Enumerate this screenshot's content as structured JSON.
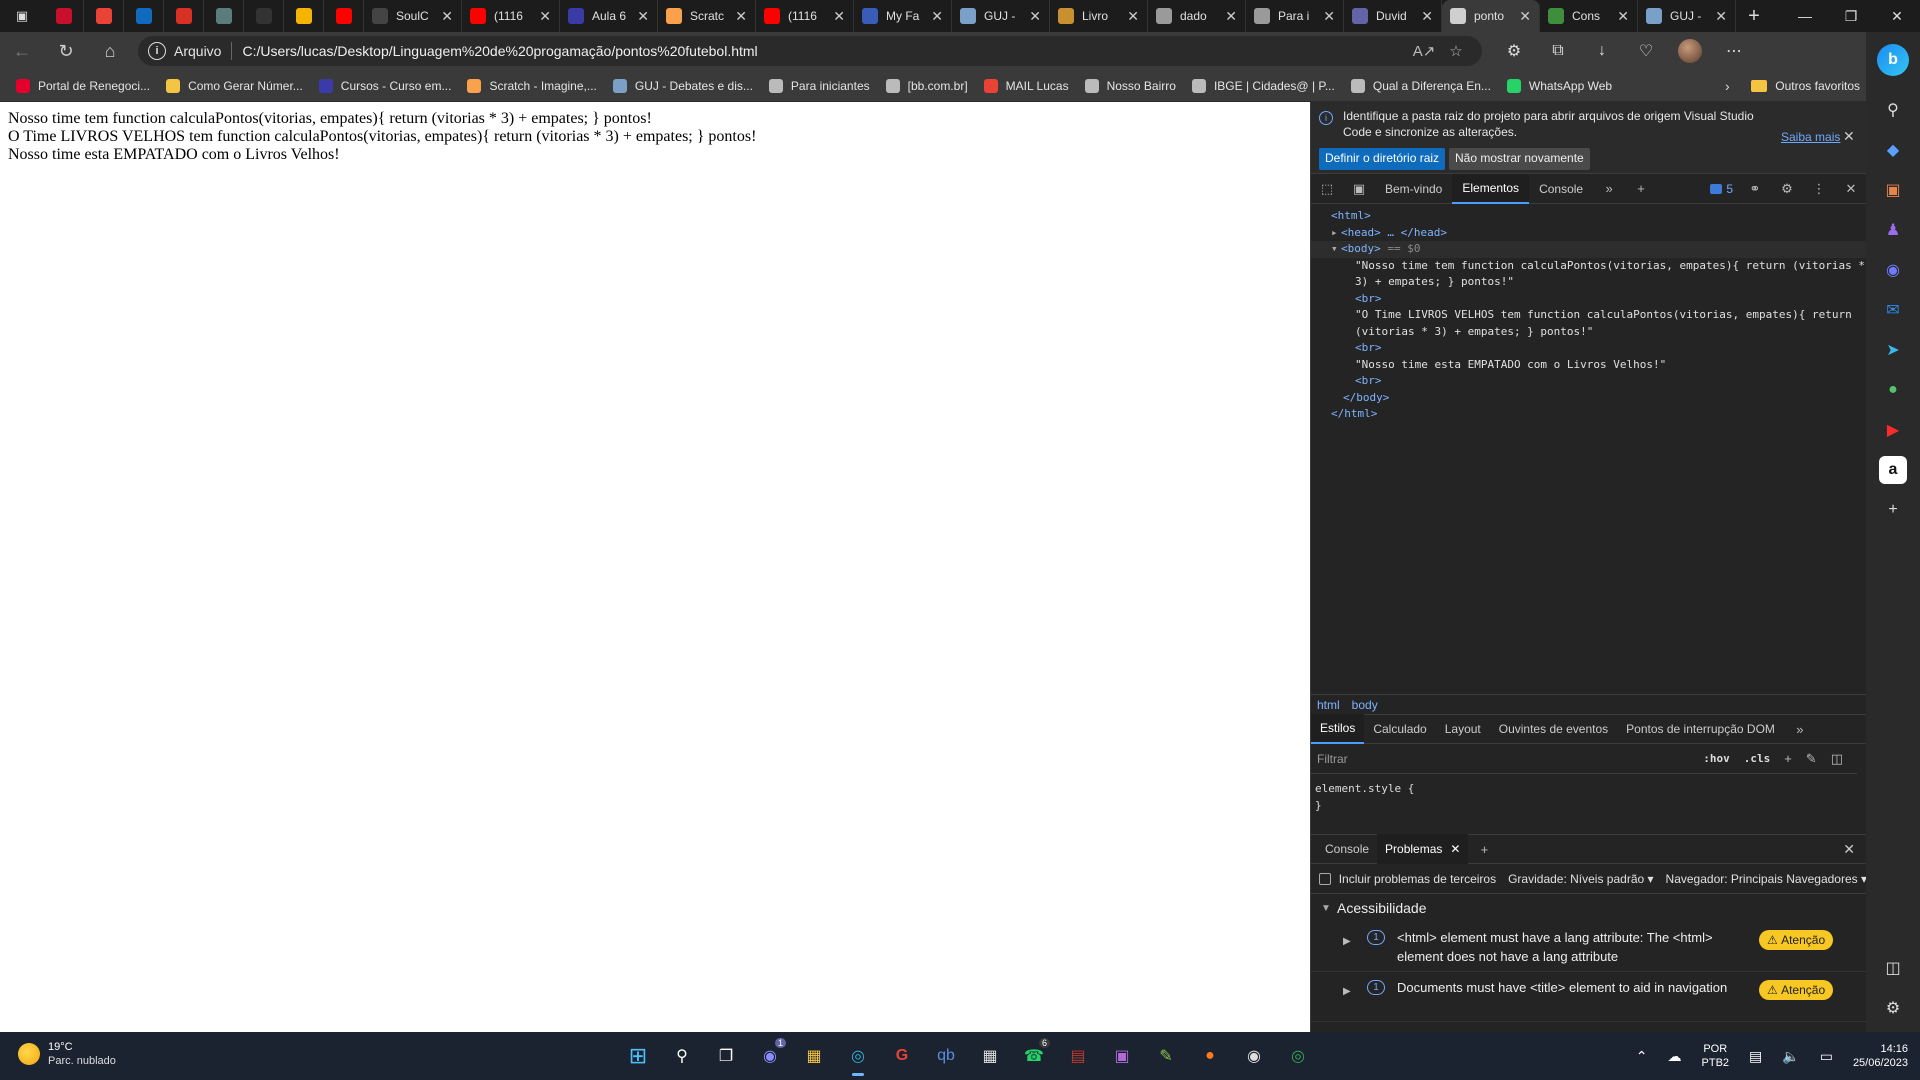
{
  "tabs": [
    {
      "title": "",
      "icon": "yammer-icon",
      "color": "#c8102e",
      "mini": true
    },
    {
      "title": "",
      "icon": "gmail-icon",
      "color": "#ea4335",
      "mini": true
    },
    {
      "title": "",
      "icon": "outlook-icon",
      "color": "#0f6cbd",
      "mini": true
    },
    {
      "title": "",
      "icon": "g-icon",
      "color": "#d93025",
      "mini": true
    },
    {
      "title": "",
      "icon": "generic-site-icon",
      "color": "#5a7d7c",
      "mini": true
    },
    {
      "title": "",
      "icon": "terminal-icon",
      "color": "#333333",
      "mini": true
    },
    {
      "title": "",
      "icon": "maps-pin-icon",
      "color": "#f4b400",
      "mini": true
    },
    {
      "title": "",
      "icon": "youtube-icon",
      "color": "#ff0000",
      "mini": true
    },
    {
      "title": "SoulC",
      "icon": "generic-site-icon",
      "color": "#444444",
      "mini": false
    },
    {
      "title": "(1116",
      "icon": "youtube-icon",
      "color": "#ff0000",
      "mini": false
    },
    {
      "title": "Aula 6",
      "icon": "generic-site-icon",
      "color": "#3a3aa8",
      "mini": false
    },
    {
      "title": "Scratc",
      "icon": "scratch-icon",
      "color": "#f9a24b",
      "mini": false
    },
    {
      "title": "(1116",
      "icon": "youtube-icon",
      "color": "#ff0000",
      "mini": false
    },
    {
      "title": "My Fa",
      "icon": "generic-site-icon",
      "color": "#3a5bb8",
      "mini": false
    },
    {
      "title": "GUJ -",
      "icon": "guj-icon",
      "color": "#7aa0c8",
      "mini": false
    },
    {
      "title": "Livro",
      "icon": "book-icon",
      "color": "#c8902e",
      "mini": false
    },
    {
      "title": "dado",
      "icon": "file-icon",
      "color": "#9a9a9a",
      "mini": false
    },
    {
      "title": "Para i",
      "icon": "file-icon",
      "color": "#9a9a9a",
      "mini": false
    },
    {
      "title": "Duvid",
      "icon": "teams-icon",
      "color": "#6264a7",
      "mini": false
    },
    {
      "title": "ponto",
      "icon": "file-icon",
      "color": "#cfcfcf",
      "mini": false,
      "active": true
    },
    {
      "title": "Cons",
      "icon": "generic-site-icon",
      "color": "#3e8e3e",
      "mini": false
    },
    {
      "title": "GUJ -",
      "icon": "guj-icon",
      "color": "#7aa0c8",
      "mini": false
    }
  ],
  "address": {
    "scheme": "Arquivo",
    "url": "C:/Users/lucas/Desktop/Linguagem%20de%20progamação/pontos%20futebol.html"
  },
  "favorites": [
    {
      "label": "Portal de Renegoci...",
      "icon": "serasa-icon",
      "color": "#e4002b"
    },
    {
      "label": "Como Gerar Númer...",
      "icon": "python-icon",
      "color": "#f4c542"
    },
    {
      "label": "Cursos - Curso em...",
      "icon": "cursoemvideo-icon",
      "color": "#3a3aa8"
    },
    {
      "label": "Scratch - Imagine,...",
      "icon": "scratch-icon",
      "color": "#f9a24b"
    },
    {
      "label": "GUJ - Debates e dis...",
      "icon": "guj-icon",
      "color": "#7aa0c8"
    },
    {
      "label": "Para iniciantes",
      "icon": "file-icon",
      "color": "#bbbbbb"
    },
    {
      "label": "[bb.com.br]",
      "icon": "file-icon",
      "color": "#bbbbbb"
    },
    {
      "label": "MAIL Lucas",
      "icon": "gmail-icon",
      "color": "#ea4335"
    },
    {
      "label": "Nosso Bairro",
      "icon": "file-icon",
      "color": "#bbbbbb"
    },
    {
      "label": "IBGE | Cidades@ | P...",
      "icon": "file-icon",
      "color": "#bbbbbb"
    },
    {
      "label": "Qual a Diferença En...",
      "icon": "file-icon",
      "color": "#bbbbbb"
    },
    {
      "label": "WhatsApp Web",
      "icon": "whatsapp-icon",
      "color": "#25d366"
    }
  ],
  "favorites_folder": "Outros favoritos",
  "page": {
    "line1": "Nosso time tem function calculaPontos(vitorias, empates){ return (vitorias * 3) + empates; } pontos!",
    "line2": "O Time LIVROS VELHOS tem function calculaPontos(vitorias, empates){ return (vitorias * 3) + empates; } pontos!",
    "line3": "Nosso time esta EMPATADO com o Livros Velhos!"
  },
  "devtools": {
    "infobar": {
      "message": "Identifique a pasta raiz do projeto para abrir arquivos de origem Visual Studio Code e sincronize as alterações.",
      "learn_more": "Saiba mais",
      "primary": "Definir o diretório raiz",
      "secondary": "Não mostrar novamente"
    },
    "tabs": [
      "Bem-vindo",
      "Elementos",
      "Console"
    ],
    "issues_count": "5",
    "dom": {
      "html_open": "<html>",
      "head": "<head> … </head>",
      "body_open": "<body>",
      "body_hint": "== $0",
      "text1a": "\"Nosso time tem function calculaPontos(vitorias, empates){ return (vitorias *",
      "text1b": "3) + empates; } pontos!\"",
      "br": "<br>",
      "text2a": "\"O Time LIVROS VELHOS tem function calculaPontos(vitorias, empates){ return",
      "text2b": "(vitorias * 3) + empates; } pontos!\"",
      "text3": "\"Nosso time esta EMPATADO com o Livros Velhos!\"",
      "body_close": "</body>",
      "html_close": "</html>"
    },
    "breadcrumbs": [
      "html",
      "body"
    ],
    "style_tabs": [
      "Estilos",
      "Calculado",
      "Layout",
      "Ouvintes de eventos",
      "Pontos de interrupção DOM"
    ],
    "filter_placeholder": "Filtrar",
    "hov": ":hov",
    "cls": ".cls",
    "style_rule_open": "element.style {",
    "style_rule_close": "}",
    "drawer_tabs": [
      "Console",
      "Problemas"
    ],
    "issues_options": {
      "third_party": "Incluir problemas de terceiros",
      "severity": "Gravidade: Níveis padrão",
      "browser": "Navegador: Principais Navegadores"
    },
    "category": "Acessibilidade",
    "issues": [
      {
        "count": "1",
        "text": "<html> element must have a lang attribute: The <html> element does not have a lang attribute",
        "badge": "Atenção"
      },
      {
        "count": "1",
        "text": "Documents must have <title> element to aid in navigation",
        "badge": "Atenção"
      }
    ]
  },
  "taskbar": {
    "temperature": "19°C",
    "weather": "Parc. nublado",
    "lang1": "POR",
    "lang2": "PTB2",
    "time": "14:16",
    "date": "25/06/2023",
    "chat_badge": "1",
    "whatsapp_badge": "6"
  }
}
